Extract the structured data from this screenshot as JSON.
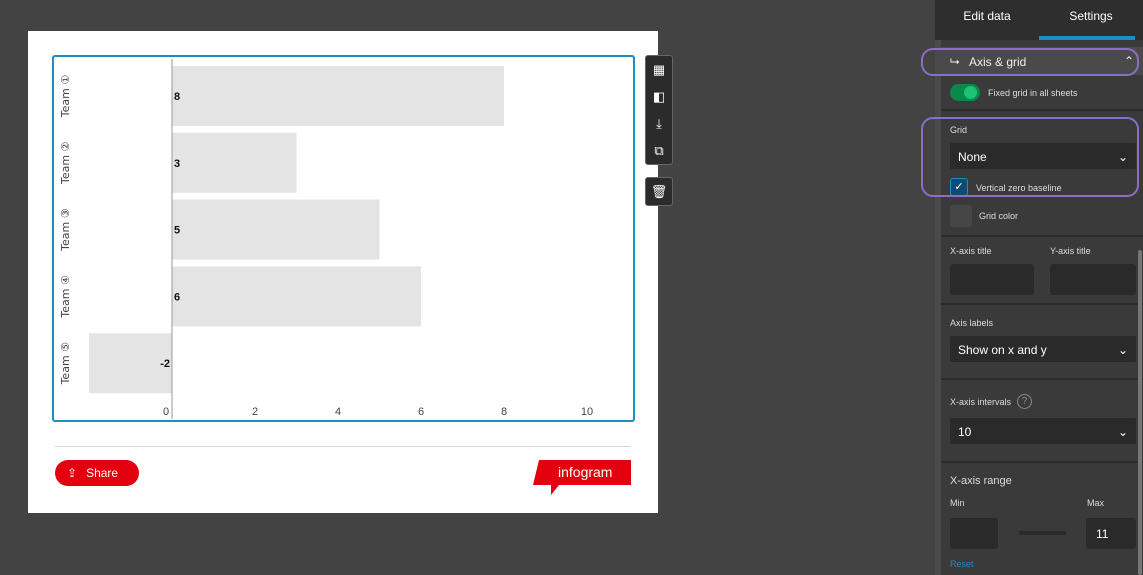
{
  "chart_data": {
    "type": "bar",
    "orientation": "horizontal",
    "categories": [
      "Team ①",
      "Team ②",
      "Team ③",
      "Team ④",
      "Team ⑤"
    ],
    "values": [
      8,
      3,
      5,
      6,
      -2
    ],
    "x_ticks": [
      0,
      2,
      4,
      6,
      8,
      10
    ],
    "xlim": [
      -2,
      11
    ],
    "grid": false,
    "zero_baseline": true,
    "bar_color": "#e4e4e4",
    "data_labels": [
      "8",
      "3",
      "5",
      "6",
      "-2"
    ]
  },
  "footer": {
    "share_label": "Share",
    "logo_text": "infogram",
    "accent": "#e3000f"
  },
  "toolbar": {
    "icons": [
      "grid-icon",
      "swap-icon",
      "download-icon",
      "duplicate-icon"
    ],
    "delete": "trash-icon"
  },
  "panel": {
    "tabs": [
      "Edit data",
      "Settings"
    ],
    "active_tab": "Settings",
    "section_title": "Axis & grid",
    "fixed_grid_label": "Fixed grid in all sheets",
    "fixed_grid_on": true,
    "grid_label": "Grid",
    "grid_value": "None",
    "zero_baseline_label": "Vertical zero baseline",
    "zero_baseline_checked": true,
    "grid_color_label": "Grid color",
    "x_axis_title_label": "X-axis title",
    "y_axis_title_label": "Y-axis title",
    "axis_labels_label": "Axis labels",
    "axis_labels_value": "Show on x and y",
    "x_intervals_label": "X-axis intervals",
    "x_intervals_value": "10",
    "x_range_label": "X-axis range",
    "min_label": "Min",
    "max_label": "Max",
    "min_value": "",
    "max_value": "11",
    "reset_label": "Reset"
  }
}
